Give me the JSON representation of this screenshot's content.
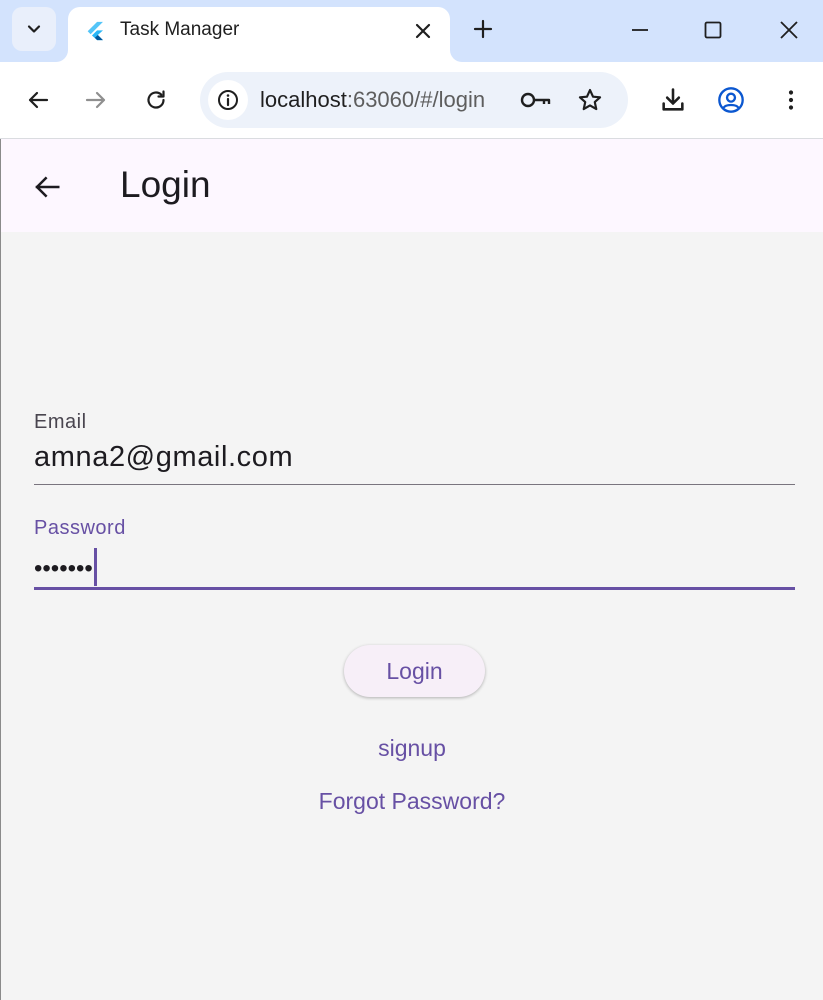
{
  "browser": {
    "tab_title": "Task Manager",
    "url_host": "localhost",
    "url_path": ":63060/#/login",
    "accent": "#0b57d0"
  },
  "appbar": {
    "title": "Login"
  },
  "form": {
    "email_label": "Email",
    "email_value": "amna2@gmail.com",
    "password_label": "Password",
    "password_value": "•••••••",
    "login_label": "Login",
    "signup_label": "signup",
    "forgot_label": "Forgot Password?"
  },
  "colors": {
    "primary": "#6750a4",
    "appbar_bg": "#fdf7ff",
    "content_bg": "#f4f4f4"
  },
  "icons": [
    "tab-search-icon",
    "flutter-logo-icon",
    "close-icon",
    "plus-icon",
    "minimize-icon",
    "maximize-icon",
    "window-close-icon",
    "back-icon",
    "forward-icon",
    "reload-icon",
    "site-info-icon",
    "key-icon",
    "star-icon",
    "download-icon",
    "profile-icon",
    "more-vert-icon",
    "arrow-back-icon"
  ]
}
